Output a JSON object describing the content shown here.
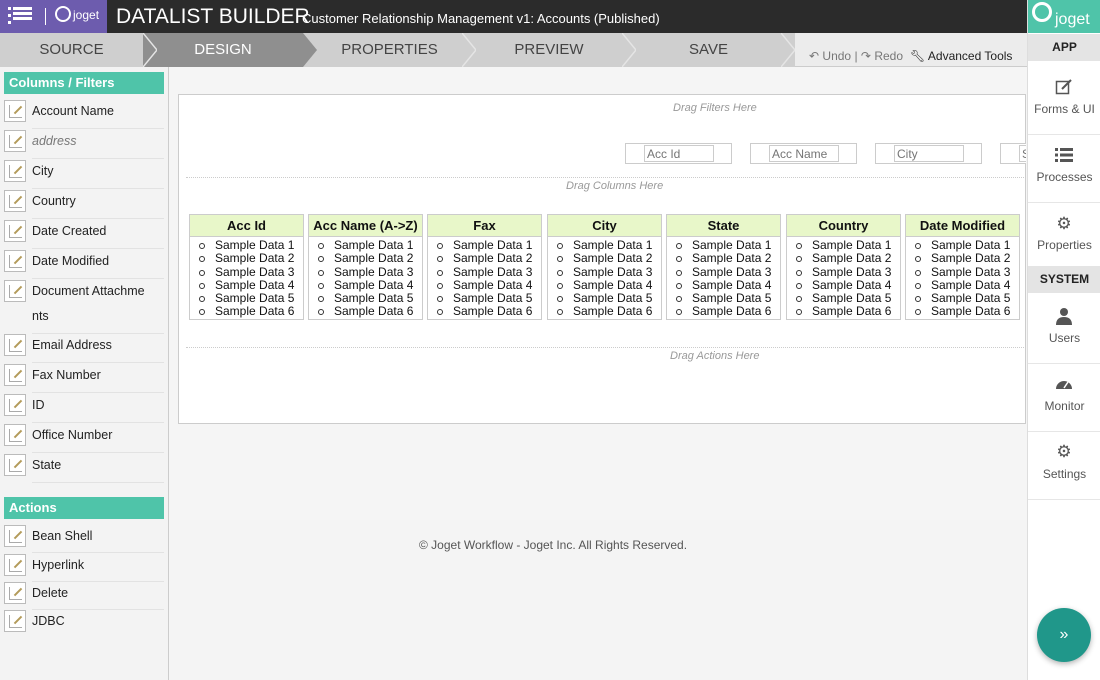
{
  "header": {
    "logo_text": "joget",
    "title": "DATALIST BUILDER",
    "subtitle": "Customer Relationship Management v1: Accounts (Published)"
  },
  "tabs": [
    {
      "label": "SOURCE"
    },
    {
      "label": "DESIGN"
    },
    {
      "label": "PROPERTIES"
    },
    {
      "label": "PREVIEW"
    },
    {
      "label": "SAVE"
    }
  ],
  "toolbar": {
    "undo": "Undo",
    "separator": "|",
    "redo": "Redo",
    "advanced_tools": "Advanced Tools"
  },
  "palette": {
    "columns_heading": "Columns / Filters",
    "columns": [
      {
        "label": "Account Name"
      },
      {
        "label": "address"
      },
      {
        "label": "City"
      },
      {
        "label": "Country"
      },
      {
        "label": "Date Created"
      },
      {
        "label": "Date Modified"
      },
      {
        "label": "Document Attachme",
        "label2": "nts"
      },
      {
        "label": "Email Address"
      },
      {
        "label": "Fax Number"
      },
      {
        "label": "ID"
      },
      {
        "label": "Office Number"
      },
      {
        "label": "State"
      }
    ],
    "actions_heading": "Actions",
    "actions": [
      {
        "label": "Bean Shell"
      },
      {
        "label": "Hyperlink"
      },
      {
        "label": "Delete"
      },
      {
        "label": "JDBC"
      }
    ]
  },
  "canvas": {
    "drag_filters": "Drag Filters Here",
    "drag_columns": "Drag Columns Here",
    "drag_actions": "Drag Actions Here",
    "filters": [
      {
        "placeholder": "Acc Id"
      },
      {
        "placeholder": "Acc Name"
      },
      {
        "placeholder": "City"
      },
      {
        "placeholder": "State"
      }
    ],
    "columns": [
      {
        "header": "Acc Id"
      },
      {
        "header": "Acc Name (A->Z)"
      },
      {
        "header": "Fax"
      },
      {
        "header": "City"
      },
      {
        "header": "State"
      },
      {
        "header": "Country"
      },
      {
        "header": "Date Modified"
      }
    ],
    "sample_rows": [
      "Sample Data 1",
      "Sample Data 2",
      "Sample Data 3",
      "Sample Data 4",
      "Sample Data 5",
      "Sample Data 6"
    ]
  },
  "footer": {
    "text": "© Joget Workflow - Joget Inc. All Rights Reserved."
  },
  "right_nav": {
    "logo_text": "joget",
    "app_section": "APP",
    "system_section": "SYSTEM",
    "items": [
      {
        "label": "Forms & UI",
        "icon": "edit-icon"
      },
      {
        "label": "Processes",
        "icon": "list-icon"
      },
      {
        "label": "Properties",
        "icon": "gear-icon"
      },
      {
        "label": "Users",
        "icon": "user-icon"
      },
      {
        "label": "Monitor",
        "icon": "dashboard-icon"
      },
      {
        "label": "Settings",
        "icon": "gears-icon"
      }
    ],
    "fab_icon": "»"
  },
  "colors": {
    "accent": "#4fc4a9",
    "menu_purple": "#6d5cae",
    "header_bg": "#2b2b2b",
    "column_header_bg": "#e8f7c9",
    "fab": "#20978a"
  }
}
